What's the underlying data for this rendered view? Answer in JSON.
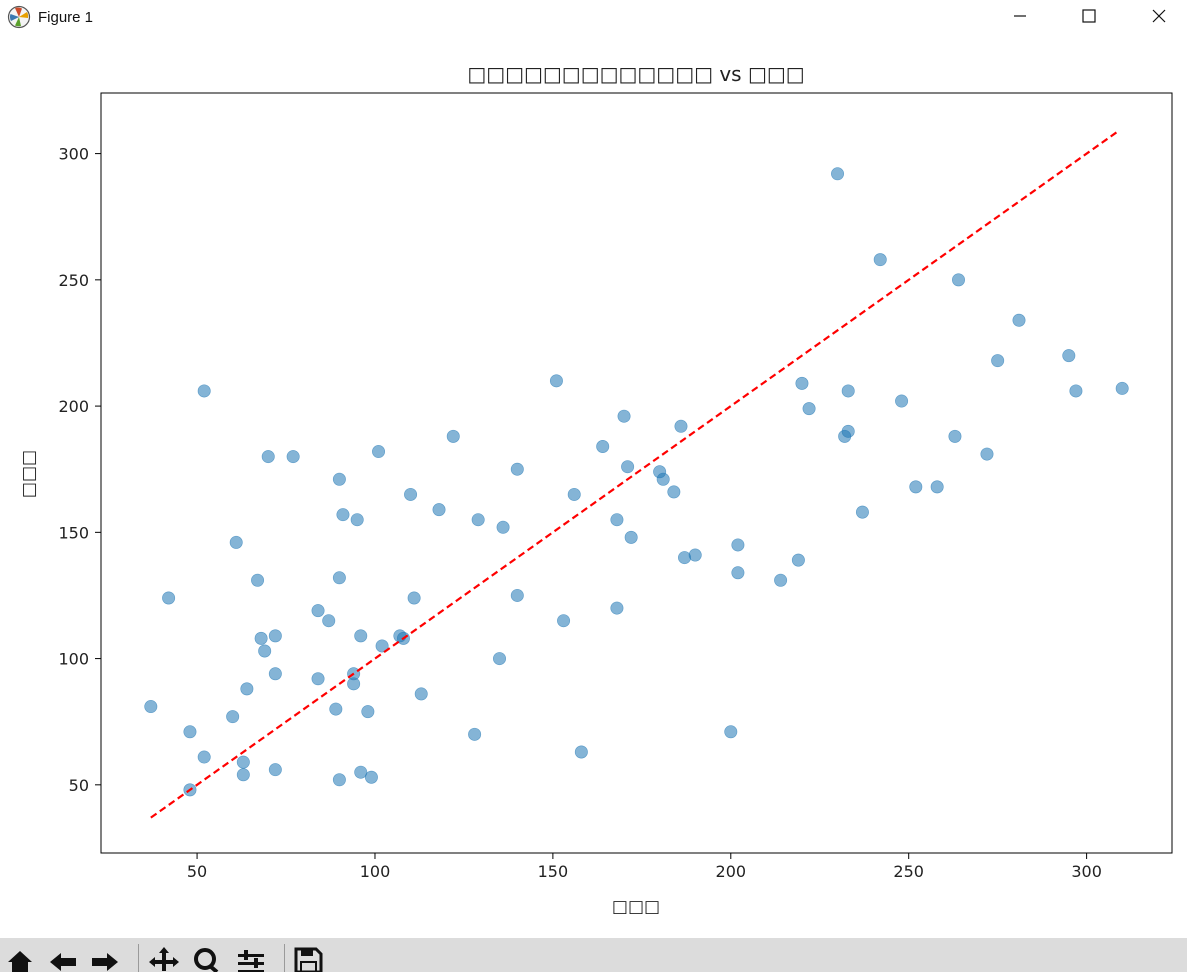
{
  "window": {
    "title": "Figure 1",
    "controls": [
      "minimize",
      "maximize",
      "close"
    ]
  },
  "toolbar": {
    "icons": [
      "home-icon",
      "back-icon",
      "forward-icon",
      "pan-icon",
      "zoom-icon",
      "configure-icon",
      "save-icon"
    ]
  },
  "colors": {
    "points": "#1f77b4",
    "reference_line": "#ff0000",
    "toolbar_bg": "#dcdcdc"
  },
  "chart_data": {
    "type": "scatter",
    "title": "□□□□□□□□□□□□□ vs □□□",
    "xlabel": "□□□",
    "ylabel": "□□□",
    "xlim": [
      23,
      324
    ],
    "ylim": [
      23,
      324
    ],
    "x_ticks": [
      50,
      100,
      150,
      200,
      250,
      300
    ],
    "y_ticks": [
      50,
      100,
      150,
      200,
      250,
      300
    ],
    "grid": false,
    "legend": "none",
    "reference_line": {
      "style": "dashed",
      "color": "red",
      "from": [
        37,
        37
      ],
      "to": [
        309,
        309
      ]
    },
    "points": [
      [
        37,
        81
      ],
      [
        42,
        124
      ],
      [
        48,
        71
      ],
      [
        48,
        48
      ],
      [
        52,
        206
      ],
      [
        52,
        61
      ],
      [
        60,
        77
      ],
      [
        61,
        146
      ],
      [
        63,
        59
      ],
      [
        63,
        54
      ],
      [
        64,
        88
      ],
      [
        67,
        131
      ],
      [
        68,
        108
      ],
      [
        69,
        103
      ],
      [
        70,
        180
      ],
      [
        72,
        109
      ],
      [
        72,
        94
      ],
      [
        72,
        56
      ],
      [
        77,
        180
      ],
      [
        84,
        119
      ],
      [
        84,
        92
      ],
      [
        87,
        115
      ],
      [
        89,
        80
      ],
      [
        90,
        171
      ],
      [
        90,
        132
      ],
      [
        90,
        52
      ],
      [
        91,
        157
      ],
      [
        94,
        94
      ],
      [
        94,
        90
      ],
      [
        95,
        155
      ],
      [
        96,
        109
      ],
      [
        96,
        55
      ],
      [
        98,
        79
      ],
      [
        99,
        53
      ],
      [
        101,
        182
      ],
      [
        102,
        105
      ],
      [
        107,
        109
      ],
      [
        108,
        108
      ],
      [
        110,
        165
      ],
      [
        111,
        124
      ],
      [
        113,
        86
      ],
      [
        118,
        159
      ],
      [
        122,
        188
      ],
      [
        128,
        70
      ],
      [
        129,
        155
      ],
      [
        135,
        100
      ],
      [
        136,
        152
      ],
      [
        140,
        175
      ],
      [
        140,
        125
      ],
      [
        151,
        210
      ],
      [
        153,
        115
      ],
      [
        156,
        165
      ],
      [
        158,
        63
      ],
      [
        164,
        184
      ],
      [
        168,
        155
      ],
      [
        168,
        120
      ],
      [
        170,
        196
      ],
      [
        171,
        176
      ],
      [
        172,
        148
      ],
      [
        180,
        174
      ],
      [
        181,
        171
      ],
      [
        184,
        166
      ],
      [
        186,
        192
      ],
      [
        187,
        140
      ],
      [
        190,
        141
      ],
      [
        200,
        71
      ],
      [
        202,
        145
      ],
      [
        202,
        134
      ],
      [
        214,
        131
      ],
      [
        219,
        139
      ],
      [
        220,
        209
      ],
      [
        222,
        199
      ],
      [
        230,
        292
      ],
      [
        232,
        188
      ],
      [
        233,
        206
      ],
      [
        233,
        190
      ],
      [
        237,
        158
      ],
      [
        242,
        258
      ],
      [
        248,
        202
      ],
      [
        252,
        168
      ],
      [
        258,
        168
      ],
      [
        263,
        188
      ],
      [
        264,
        250
      ],
      [
        272,
        181
      ],
      [
        275,
        218
      ],
      [
        281,
        234
      ],
      [
        295,
        220
      ],
      [
        297,
        206
      ],
      [
        310,
        207
      ]
    ]
  }
}
